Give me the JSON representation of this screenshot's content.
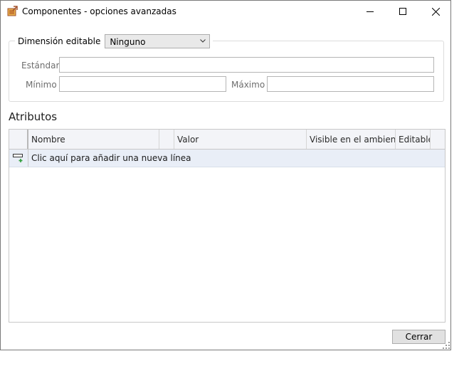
{
  "window": {
    "title": "Componentes - opciones avanzadas",
    "controls": {
      "minimize": "minimize-icon",
      "maximize": "maximize-icon",
      "close": "close-icon"
    }
  },
  "editable": {
    "label": "Dimensión editable",
    "selected": "Ninguno",
    "fields": {
      "standard_label": "Estándar",
      "standard_value": "",
      "min_label": "Mínimo",
      "min_value": "",
      "max_label": "Máximo",
      "max_value": ""
    }
  },
  "attributes": {
    "title": "Atributos",
    "columns": [
      "Nombre",
      "",
      "Valor",
      "Visible en el ambiente",
      "Editable"
    ],
    "new_row_text": "Clic aquí para añadir una nueva línea"
  },
  "footer": {
    "close_label": "Cerrar"
  },
  "colors": {
    "icon_brown": "#a0522d",
    "icon_orange": "#e8b04c",
    "add_green": "#2e9e3a"
  }
}
